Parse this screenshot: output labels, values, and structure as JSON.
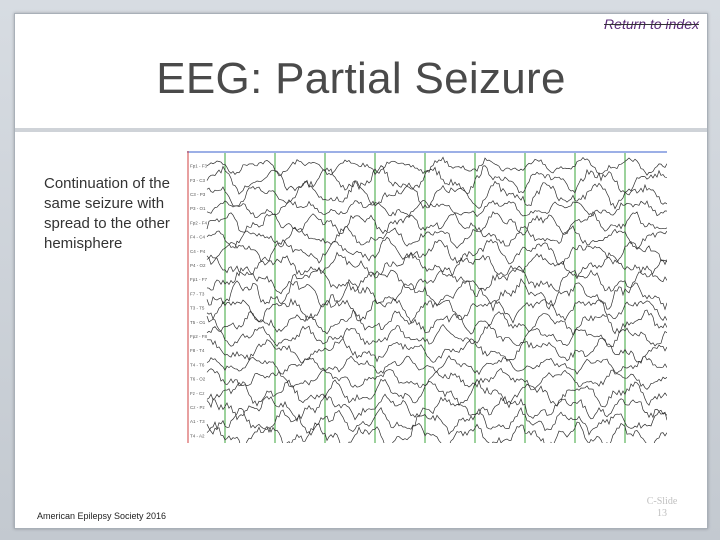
{
  "slide": {
    "return_link": "Return to index",
    "title": "EEG: Partial Seizure",
    "body": "Continuation of the same seizure with spread to the other hemisphere",
    "footer": "American Epilepsy Society 2016",
    "slide_num_line1": "C-Slide",
    "slide_num_line2": "13"
  },
  "eeg": {
    "channel_labels": [
      "Fp1 - F3",
      "F3 - C3",
      "C3 - P3",
      "P3 - O1",
      "Fp2 - F4",
      "F4 - C4",
      "C4 - P4",
      "P4 - O2",
      "Fp1 - F7",
      "F7 - T3",
      "T3 - T5",
      "T5 - O1",
      "Fp2 - F8",
      "F8 - T4",
      "T4 - T6",
      "T6 - O2",
      "Fz - Cz",
      "Cz - Pz",
      "A1 - T3",
      "T4 - A2"
    ],
    "colors": {
      "trace": "#2e2e2e",
      "second_marker": "#3aa53a",
      "top_line": "#3a5fcd",
      "left_border": "#d04040"
    }
  }
}
